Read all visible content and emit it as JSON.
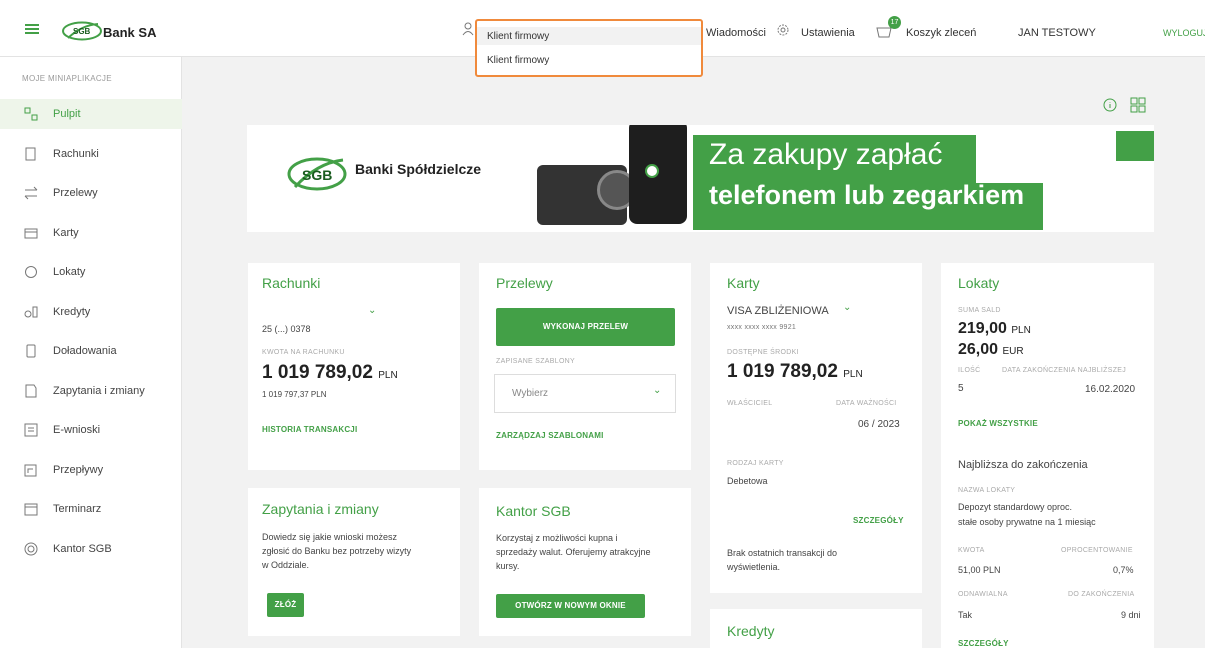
{
  "header": {
    "bank_name": "Bank SA",
    "messages": "Wiadomości",
    "settings": "Ustawienia",
    "cart": "Koszyk zleceń",
    "cart_badge": "17",
    "user": "JAN TESTOWY",
    "logout": "WYLOGUJ"
  },
  "profile_dropdown": {
    "selected": "Klient firmowy",
    "options": [
      "Klient firmowy"
    ]
  },
  "sidebar": {
    "heading": "MOJE MINIAPLIKACJE",
    "items": [
      {
        "label": "Pulpit",
        "icon": "dashboard-icon"
      },
      {
        "label": "Rachunki",
        "icon": "accounts-icon"
      },
      {
        "label": "Przelewy",
        "icon": "transfer-icon"
      },
      {
        "label": "Karty",
        "icon": "card-icon"
      },
      {
        "label": "Lokaty",
        "icon": "deposit-icon"
      },
      {
        "label": "Kredyty",
        "icon": "credit-icon"
      },
      {
        "label": "Doładowania",
        "icon": "phone-icon"
      },
      {
        "label": "Zapytania i zmiany",
        "icon": "request-icon"
      },
      {
        "label": "E-wnioski",
        "icon": "application-icon"
      },
      {
        "label": "Przepływy",
        "icon": "flow-icon"
      },
      {
        "label": "Terminarz",
        "icon": "calendar-icon"
      },
      {
        "label": "Kantor SGB",
        "icon": "exchange-icon"
      }
    ]
  },
  "banner": {
    "brand": "Banki Spółdzielcze",
    "line1": "Za zakupy zapłać",
    "line2": "telefonem lub zegarkiem"
  },
  "rachunki": {
    "title": "Rachunki",
    "account": "25 (...) 0378",
    "balance_label": "KWOTA NA RACHUNKU",
    "balance": "1 019 789,02",
    "currency": "PLN",
    "available": "1 019 797,37 PLN",
    "history": "HISTORIA TRANSAKCJI"
  },
  "przelewy": {
    "title": "Przelewy",
    "button": "WYKONAJ PRZELEW",
    "templates_label": "ZAPISANE SZABLONY",
    "select": "Wybierz",
    "manage": "ZARZĄDZAJ SZABLONAMI"
  },
  "karty": {
    "title": "Karty",
    "card_name": "VISA ZBLIŻENIOWA",
    "card_number": "xxxx xxxx xxxx 9921",
    "available_label": "DOSTĘPNE ŚRODKI",
    "balance": "1 019 789,02",
    "currency": "PLN",
    "owner_label": "WŁAŚCICIEL",
    "expiry_label": "DATA WAŻNOŚCI",
    "expiry": "06 / 2023",
    "type_label": "RODZAJ KARTY",
    "type": "Debetowa",
    "details": "SZCZEGÓŁY",
    "no_tx": "Brak ostatnich transakcji do wyświetlenia."
  },
  "lokaty": {
    "title": "Lokaty",
    "sum_label": "SUMA SALD",
    "sum_pln": "219,00",
    "pln": "PLN",
    "sum_eur": "26,00",
    "eur": "EUR",
    "count_label": "ILOŚĆ",
    "date_label": "DATA ZAKOŃCZENIA NAJBLIŻSZEJ",
    "count": "5",
    "date": "16.02.2020",
    "show_all": "POKAŻ WSZYSTKIE",
    "nearest": "Najbliższa do zakończenia",
    "name_label": "NAZWA LOKATY",
    "name1": "Depozyt standardowy oproc.",
    "name2": "stałe osoby prywatne na 1 miesiąc",
    "amount_label": "KWOTA",
    "rate_label": "OPROCENTOWANIE",
    "amount": "51,00 PLN",
    "rate": "0,7%",
    "renew_label": "ODNAWIALNA",
    "end_label": "DO ZAKOŃCZENIA",
    "renew": "Tak",
    "end": "9 dni",
    "details": "SZCZEGÓŁY"
  },
  "zapytania": {
    "title": "Zapytania i zmiany",
    "desc1": "Dowiedz się jakie wnioski możesz",
    "desc2": "zgłosić do Banku bez potrzeby wizyty",
    "desc3": "w Oddziale.",
    "button": "ZŁÓŻ"
  },
  "kantor": {
    "title": "Kantor SGB",
    "desc1": "Korzystaj z możliwości kupna i",
    "desc2": "sprzedaży walut. Oferujemy atrakcyjne",
    "desc3": "kursy.",
    "button": "OTWÓRZ W NOWYM OKNIE"
  },
  "kredyty": {
    "title": "Kredyty"
  },
  "colors": {
    "accent": "#43a047",
    "dropdown_border": "#f08a3c"
  }
}
